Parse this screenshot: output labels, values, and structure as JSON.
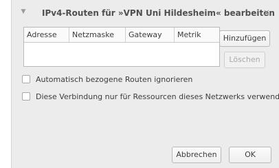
{
  "dialog": {
    "title": "IPv4-Routen für »VPN Uni Hildesheim« bearbeiten",
    "close_glyph": "×",
    "menu_glyph": "▼"
  },
  "table": {
    "columns": [
      "Adresse",
      "Netzmaske",
      "Gateway",
      "Metrik"
    ]
  },
  "buttons": {
    "add": "Hinzufügen",
    "delete": "Löschen",
    "cancel": "Abbrechen",
    "ok": "OK"
  },
  "options": {
    "ignore_auto_routes": "Automatisch bezogene Routen ignorieren",
    "only_network_resources": "Diese Verbindung nur für Ressourcen dieses Netzwerks verwenden"
  }
}
